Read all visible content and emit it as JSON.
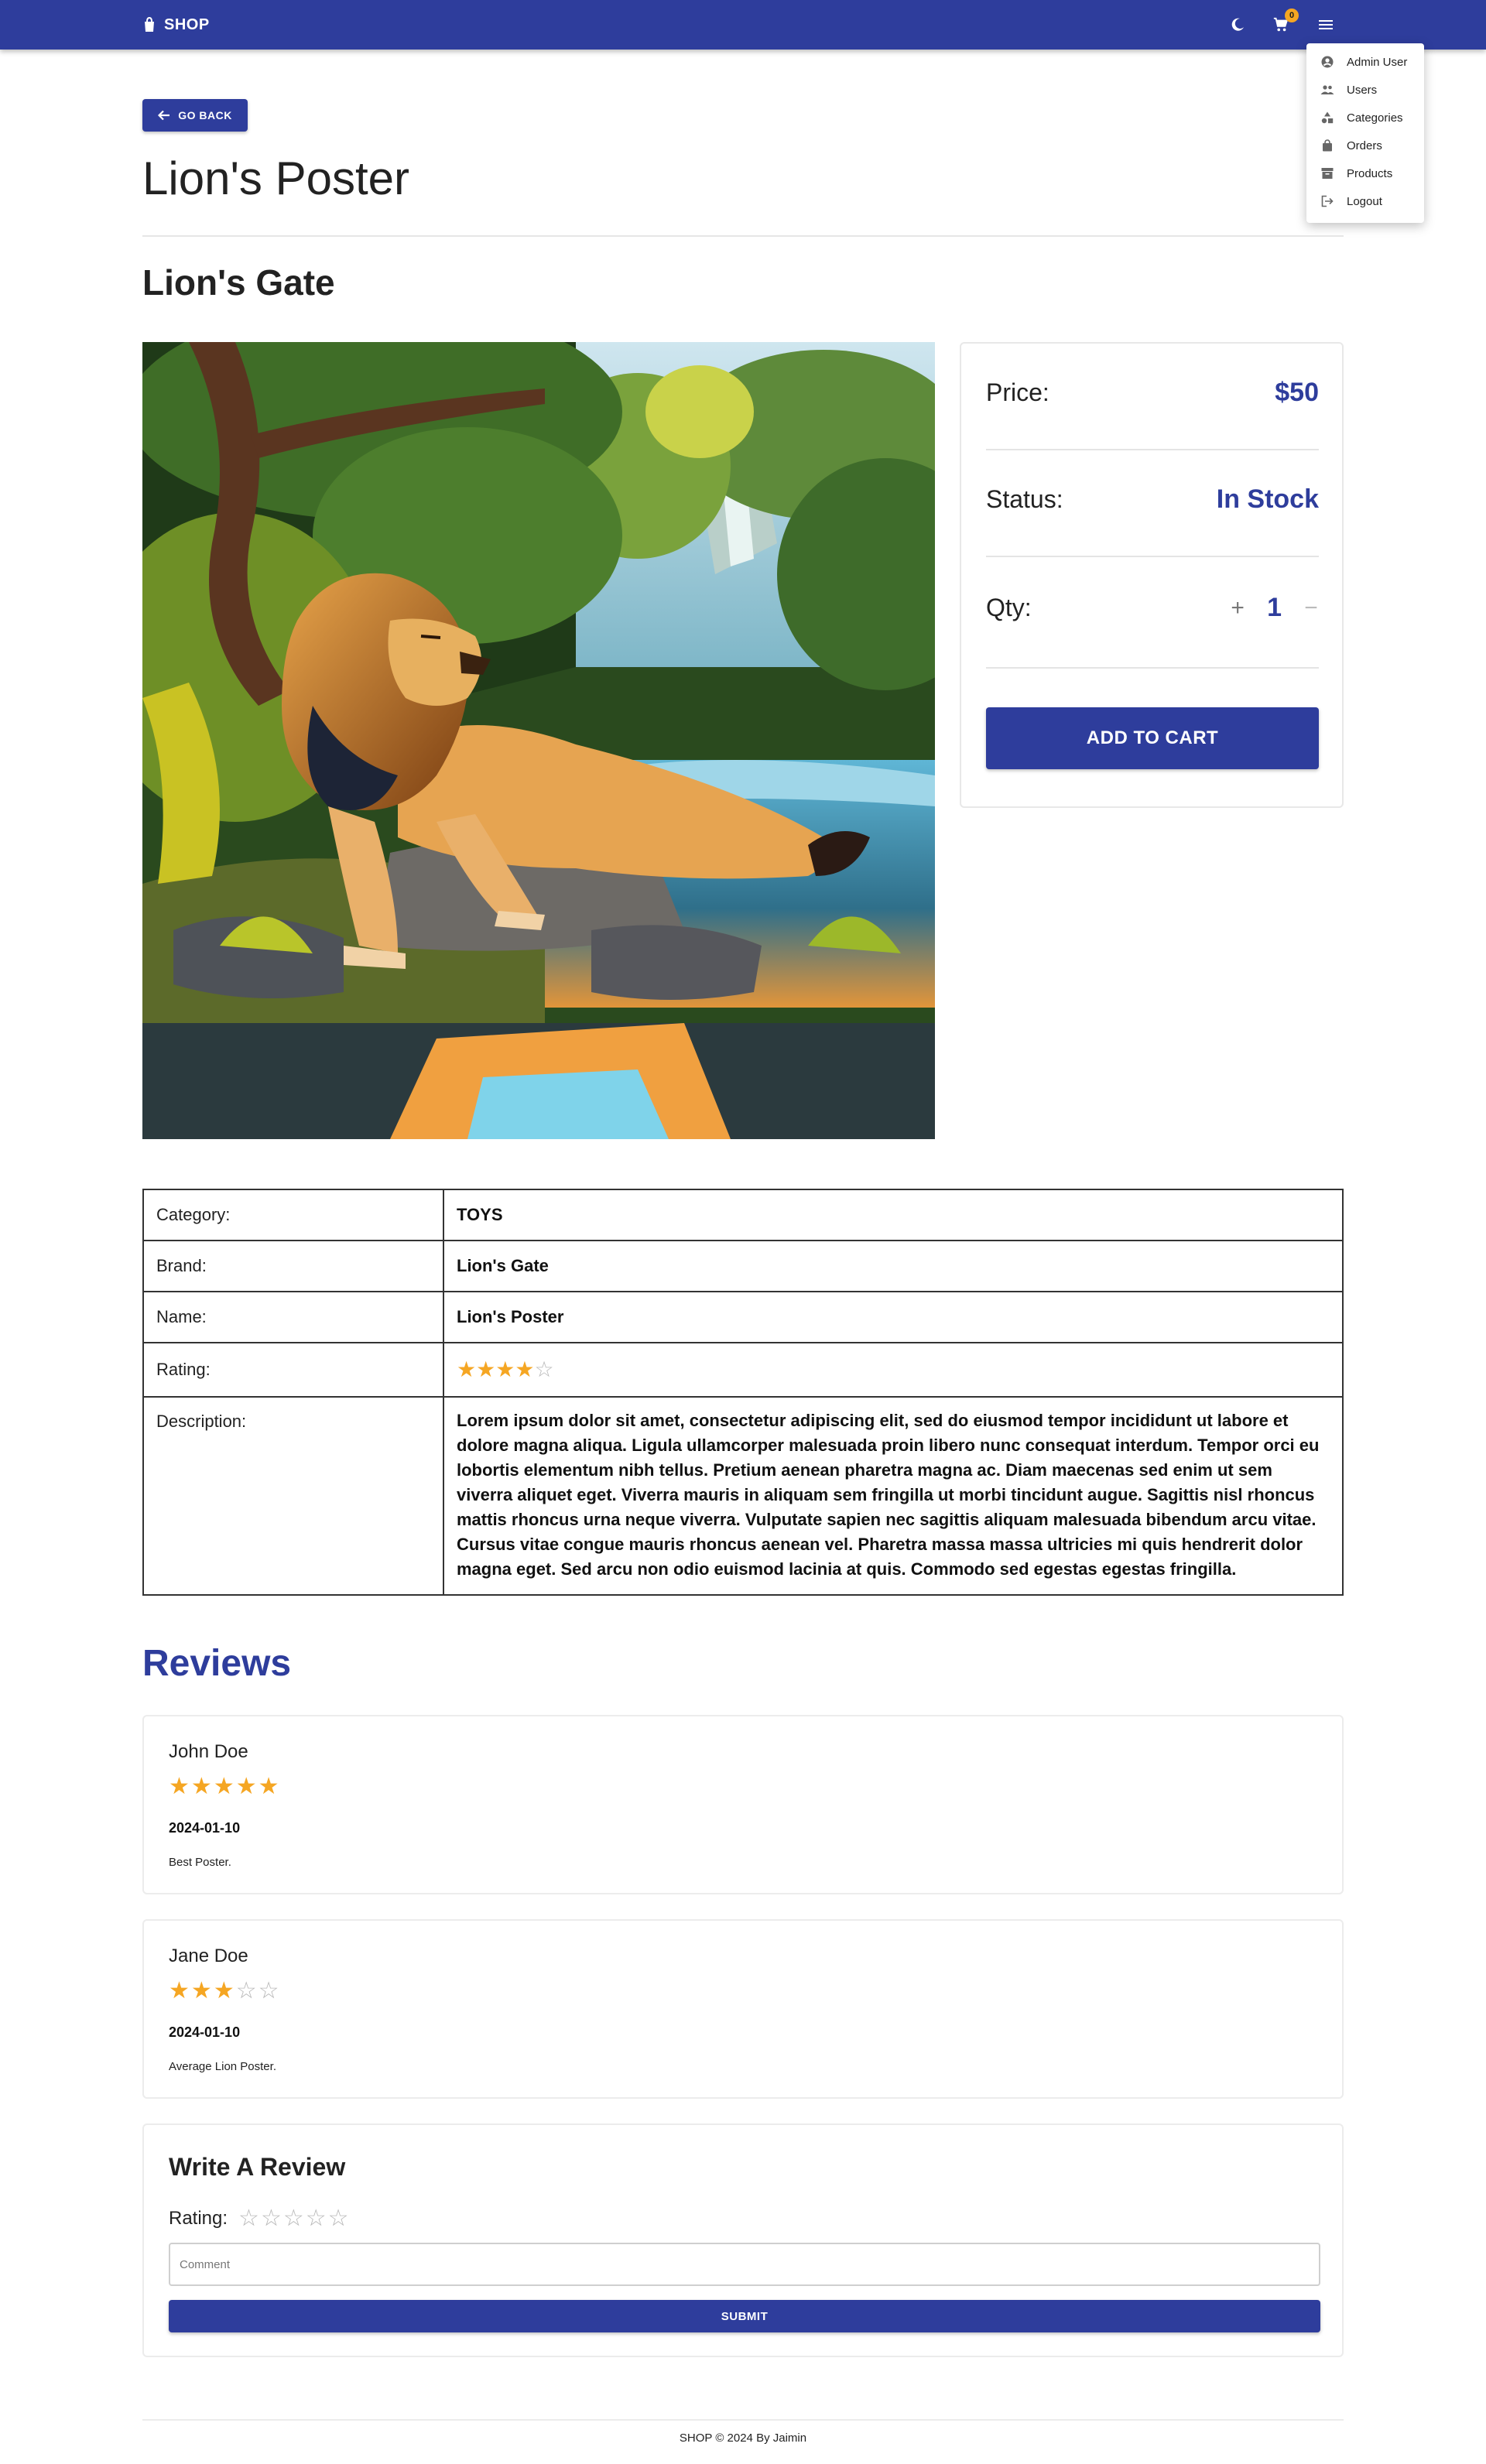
{
  "header": {
    "brand": "SHOP",
    "cart_count": "0",
    "icons": [
      "store-logo-icon",
      "dark-mode-moon-icon",
      "cart-icon",
      "menu-hamburger-icon"
    ]
  },
  "menu": {
    "items": [
      {
        "label": "Admin User",
        "icon": "account-circle-icon"
      },
      {
        "label": "Users",
        "icon": "group-icon"
      },
      {
        "label": "Categories",
        "icon": "category-icon"
      },
      {
        "label": "Orders",
        "icon": "shopping-bag-icon"
      },
      {
        "label": "Products",
        "icon": "inventory-icon"
      },
      {
        "label": "Logout",
        "icon": "logout-icon"
      }
    ]
  },
  "nav": {
    "back_label": "GO BACK"
  },
  "product": {
    "title": "Lion's Poster",
    "brand": "Lion's Gate",
    "image_alt": "Lion resting on rocks by a river"
  },
  "buy_box": {
    "price_label": "Price:",
    "price_value": "$50",
    "status_label": "Status:",
    "status_value": "In Stock",
    "qty_label": "Qty:",
    "qty_plus": "+",
    "qty_value": "1",
    "qty_minus": "−",
    "add_to_cart": "ADD TO CART"
  },
  "details": {
    "category_label": "Category:",
    "category_value": "TOYS",
    "brand_label": "Brand:",
    "brand_value": "Lion's Gate",
    "name_label": "Name:",
    "name_value": "Lion's Poster",
    "rating_label": "Rating:",
    "rating_value": 4,
    "rating_max": 5,
    "description_label": "Description:",
    "description_value": "Lorem ipsum dolor sit amet, consectetur adipiscing elit, sed do eiusmod tempor incididunt ut labore et dolore magna aliqua. Ligula ullamcorper malesuada proin libero nunc consequat interdum. Tempor orci eu lobortis elementum nibh tellus. Pretium aenean pharetra magna ac. Diam maecenas sed enim ut sem viverra aliquet eget. Viverra mauris in aliquam sem fringilla ut morbi tincidunt augue. Sagittis nisl rhoncus mattis rhoncus urna neque viverra. Vulputate sapien nec sagittis aliquam malesuada bibendum arcu vitae. Cursus vitae congue mauris rhoncus aenean vel. Pharetra massa massa ultricies mi quis hendrerit dolor magna eget. Sed arcu non odio euismod lacinia at quis. Commodo sed egestas egestas fringilla."
  },
  "reviews": {
    "heading": "Reviews",
    "items": [
      {
        "name": "John Doe",
        "rating": 5,
        "date": "2024-01-10",
        "comment": "Best Poster."
      },
      {
        "name": "Jane Doe",
        "rating": 3,
        "date": "2024-01-10",
        "comment": "Average Lion Poster."
      }
    ]
  },
  "write_review": {
    "title": "Write A Review",
    "rating_label": "Rating:",
    "rating_value": 0,
    "comment_placeholder": "Comment",
    "comment_value": "",
    "submit_label": "SUBMIT"
  },
  "footer": {
    "text": "SHOP © 2024 By Jaimin"
  },
  "colors": {
    "primary": "#2e3d9c",
    "star": "#f5a623",
    "badge": "#f5a623"
  }
}
